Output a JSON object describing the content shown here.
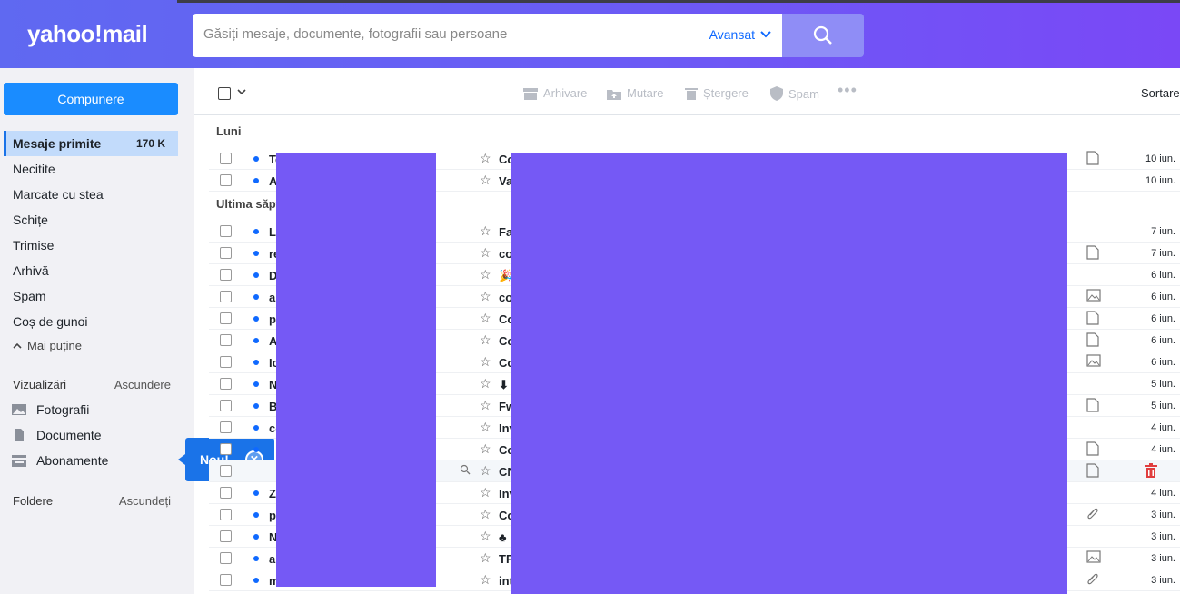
{
  "app": {
    "logo": "yahoo!mail"
  },
  "search": {
    "placeholder": "Găsiți mesaje, documente, fotografii sau persoane",
    "advanced_label": "Avansat"
  },
  "sidebar": {
    "compose_label": "Compunere",
    "folders": [
      {
        "label": "Mesaje primite",
        "count": "170 K"
      },
      {
        "label": "Necitite"
      },
      {
        "label": "Marcate cu stea"
      },
      {
        "label": "Schițe"
      },
      {
        "label": "Trimise"
      },
      {
        "label": "Arhivă"
      },
      {
        "label": "Spam"
      },
      {
        "label": "Coș de gunoi"
      }
    ],
    "less_label": "Mai puține",
    "views_title": "Vizualizări",
    "views_action": "Ascundere",
    "views": [
      {
        "label": "Fotografii",
        "icon": "photo-icon"
      },
      {
        "label": "Documente",
        "icon": "document-icon"
      },
      {
        "label": "Abonamente",
        "icon": "subscriptions-icon"
      }
    ],
    "folders_title": "Foldere",
    "folders_action": "Ascundeți"
  },
  "toast": {
    "label": "Nou!"
  },
  "toolbar": {
    "archive": "Arhivare",
    "move": "Mutare",
    "delete": "Ștergere",
    "spam": "Spam",
    "sort": "Sortare"
  },
  "groups": {
    "monday": "Luni",
    "last_week": "Ultima săpt"
  },
  "rows": [
    {
      "sender": "Teatrul Toma Caragiu Ploiești",
      "subject": "Co",
      "date": "10 iun.",
      "attachment": "doc"
    },
    {
      "sender": "A",
      "subject": "Va",
      "date": "10 iun.",
      "attachment": ""
    },
    {
      "sender": "La",
      "subject": "Fa",
      "date": "7 iun.",
      "attachment": ""
    },
    {
      "sender": "re",
      "subject": "co",
      "date": "7 iun.",
      "attachment": "doc"
    },
    {
      "sender": "D",
      "subject": "🎉",
      "date": "6 iun.",
      "attachment": ""
    },
    {
      "sender": "al",
      "subject": "co",
      "date": "6 iun.",
      "attachment": "img"
    },
    {
      "sender": "p",
      "subject": "Co",
      "date": "6 iun.",
      "attachment": "doc"
    },
    {
      "sender": "A",
      "subject": "Co",
      "date": "6 iun.",
      "attachment": "doc"
    },
    {
      "sender": "Ic",
      "subject": "Co",
      "date": "6 iun.",
      "attachment": "img"
    },
    {
      "sender": "N",
      "subject": "⬇",
      "date": "5 iun.",
      "attachment": ""
    },
    {
      "sender": "B",
      "subject": "Fw",
      "date": "5 iun.",
      "attachment": "doc"
    },
    {
      "sender": "co",
      "subject": "Inv",
      "date": "4 iun.",
      "attachment": ""
    },
    {
      "sender": "",
      "subject": "Co",
      "date": "4 iun.",
      "attachment": "doc"
    },
    {
      "sender": "",
      "subject": "CN",
      "date": "",
      "attachment": "doc"
    },
    {
      "sender": "Z",
      "subject": "Inv",
      "date": "4 iun.",
      "attachment": ""
    },
    {
      "sender": "p",
      "subject": "Co",
      "date": "3 iun.",
      "attachment": "clip"
    },
    {
      "sender": "N",
      "subject": "♣",
      "date": "3 iun.",
      "attachment": ""
    },
    {
      "sender": "al",
      "subject": "TR",
      "date": "3 iun.",
      "attachment": "img"
    },
    {
      "sender": "m",
      "subject": "int",
      "date": "3 iun.",
      "attachment": "clip"
    }
  ]
}
